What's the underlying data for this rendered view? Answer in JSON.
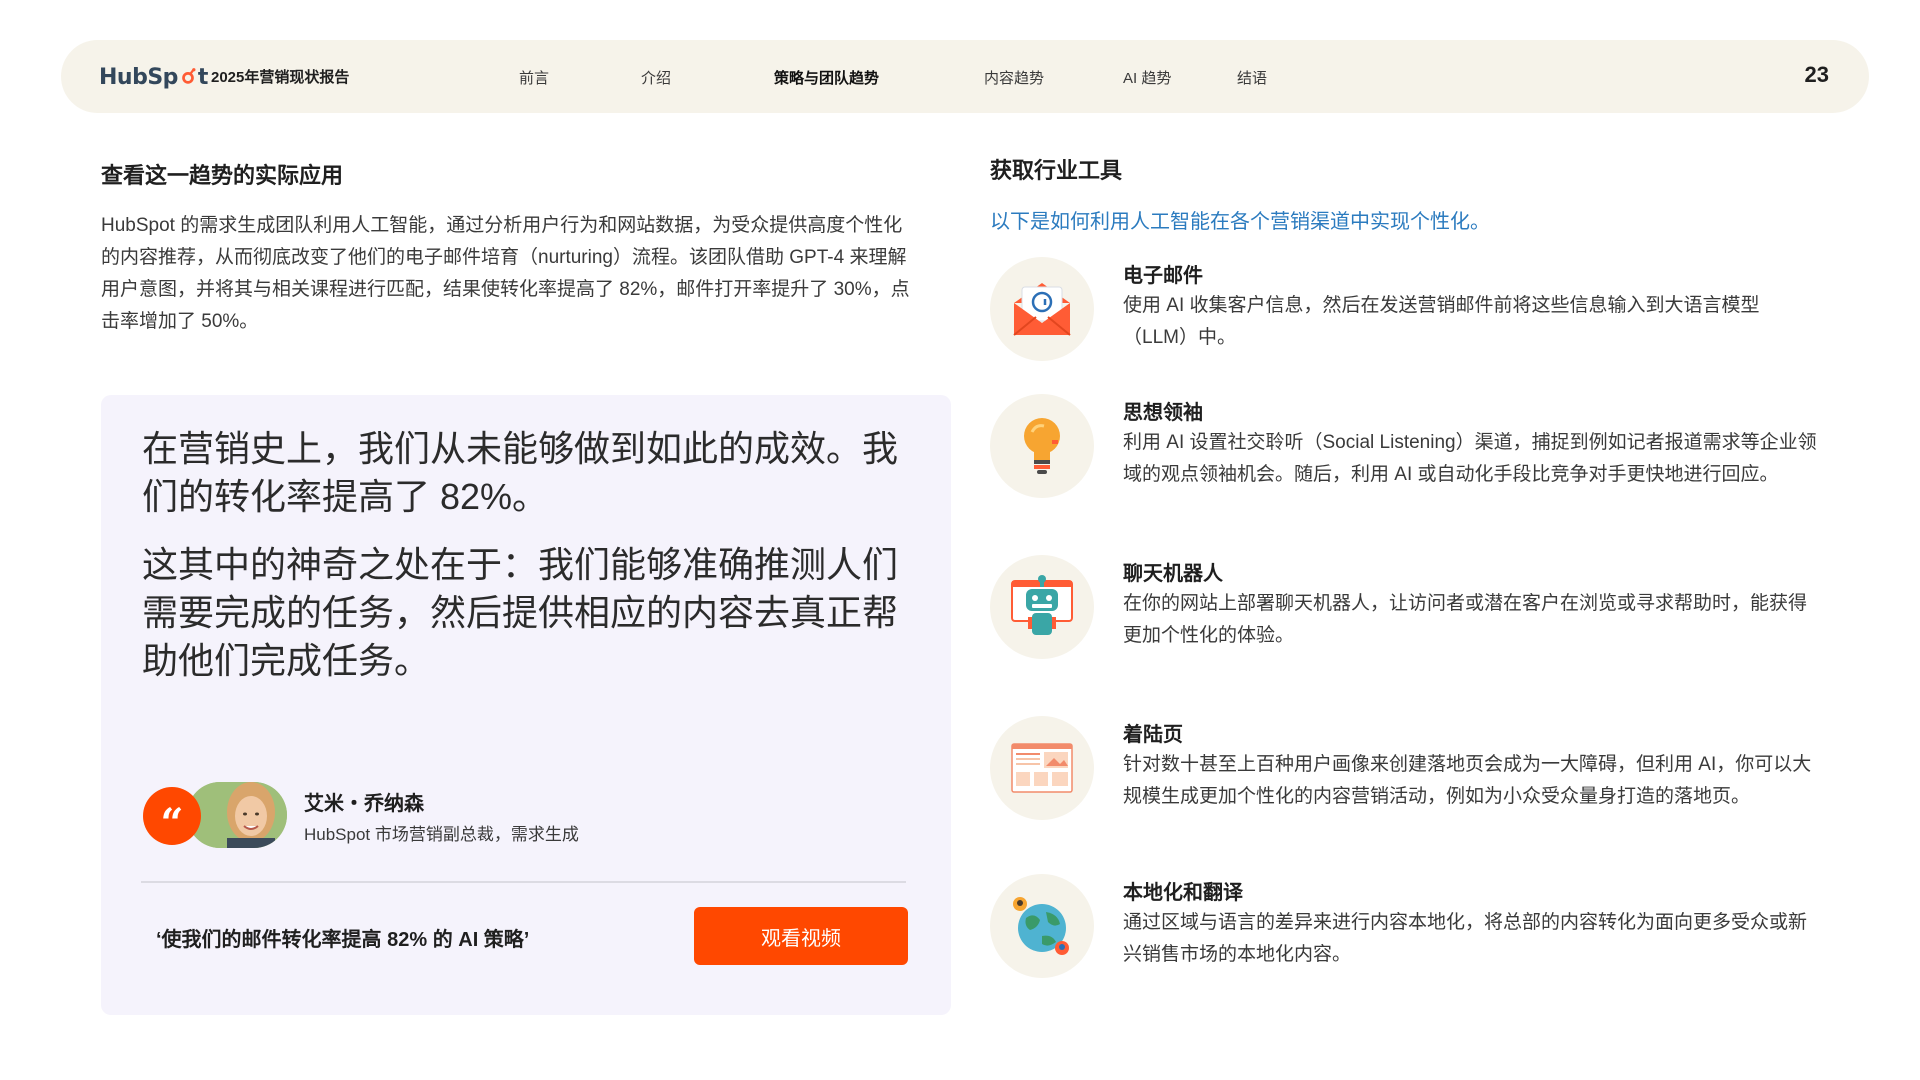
{
  "header": {
    "logo_text_a": "Hub",
    "logo_text_b": "Sp",
    "logo_text_c": "t",
    "report_title": "2025年营销现状报告",
    "nav": [
      "前言",
      "介绍",
      "策略与团队趋势",
      "内容趋势",
      "AI 趋势",
      "结语"
    ],
    "active_nav": "策略与团队趋势",
    "page_number": "23"
  },
  "left": {
    "heading": "查看这一趋势的实际应用",
    "body": "HubSpot 的需求生成团队利用人工智能，通过分析用户行为和网站数据，为受众提供高度个性化的内容推荐，从而彻底改变了他们的电子邮件培育（nurturing）流程。该团队借助 GPT-4 来理解用户意图，并将其与相关课程进行匹配，结果使转化率提高了 82%，邮件打开率提升了 30%，点击率增加了 50%。",
    "quote": {
      "paragraph1": "在营销史上，我们从未能够做到如此的成效。我们的转化率提高了 82%。",
      "paragraph2": "这其中的神奇之处在于：我们能够准确推测人们需要完成的任务，然后提供相应的内容去真正帮助他们完成任务。",
      "badge": "“",
      "person_name": "艾米・乔纳森",
      "person_title": "HubSpot 市场营销副总裁，需求生成",
      "video_caption": "‘使我们的邮件转化率提高 82% 的 AI 策略’",
      "video_button": "观看视频"
    }
  },
  "right": {
    "heading": "获取行业工具",
    "subheading": "以下是如何利用人工智能在各个营销渠道中实现个性化。",
    "tools": [
      {
        "title": "电子邮件",
        "desc": "使用 AI 收集客户信息，然后在发送营销邮件前将这些信息输入到大语言模型（LLM）中。",
        "icon": "email-icon"
      },
      {
        "title": "思想领袖",
        "desc": "利用 AI 设置社交聆听（Social Listening）渠道，捕捉到例如记者报道需求等企业领域的观点领袖机会。随后，利用 AI 或自动化手段比竞争对手更快地进行回应。",
        "icon": "lightbulb-icon"
      },
      {
        "title": "聊天机器人",
        "desc": "在你的网站上部署聊天机器人，让访问者或潜在客户在浏览或寻求帮助时，能获得更加个性化的体验。",
        "icon": "robot-icon"
      },
      {
        "title": "着陆页",
        "desc": "针对数十甚至上百种用户画像来创建落地页会成为一大障碍，但利用 AI，你可以大规模生成更加个性化的内容营销活动，例如为小众受众量身打造的落地页。",
        "icon": "landing-page-icon"
      },
      {
        "title": "本地化和翻译",
        "desc": "通过区域与语言的差异来进行内容本地化，将总部的内容转化为面向更多受众或新兴销售市场的本地化内容。",
        "icon": "globe-icon"
      }
    ]
  },
  "colors": {
    "accent": "#ff4800",
    "header_bg": "#f6f3ea",
    "card_bg": "#f5f3fc",
    "link_blue": "#2b7bbf"
  }
}
